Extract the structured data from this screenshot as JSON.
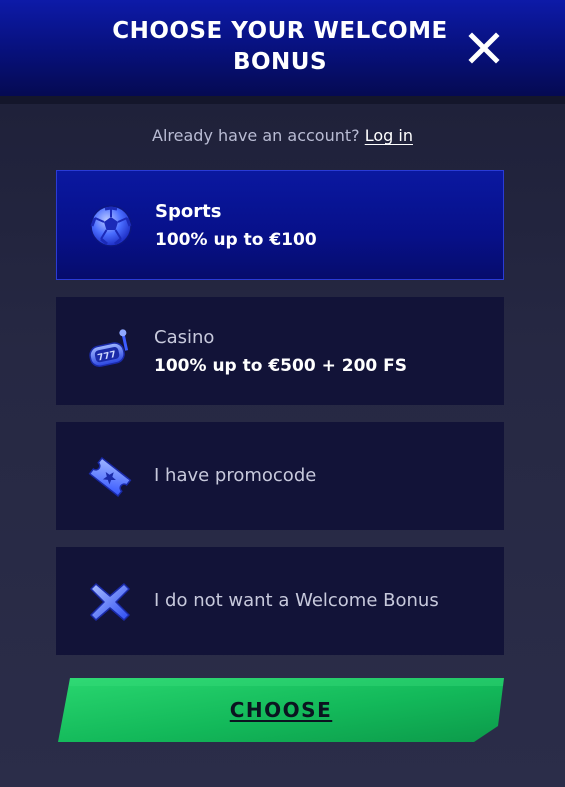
{
  "header": {
    "title": "CHOOSE YOUR WELCOME BONUS",
    "close_icon": "close-icon"
  },
  "login": {
    "prompt": "Already have an account?",
    "link_label": "Log in"
  },
  "options": [
    {
      "id": "sports",
      "title": "Sports",
      "subtitle": "100% up to €100",
      "icon": "soccer-ball-icon",
      "selected": true
    },
    {
      "id": "casino",
      "title": "Casino",
      "subtitle": "100% up to €500 + 200 FS",
      "icon": "slot-machine-icon",
      "selected": false
    },
    {
      "id": "promocode",
      "title": "I have promocode",
      "icon": "ticket-icon",
      "selected": false
    },
    {
      "id": "no-bonus",
      "title": "I do not want a Welcome Bonus",
      "icon": "cross-icon",
      "selected": false
    }
  ],
  "cta": {
    "label": "CHOOSE"
  },
  "colors": {
    "header": "#0a14a0",
    "selected_card": "#0a18a0",
    "card": "#121338",
    "cta_green": "#17c964",
    "background": "#272a45"
  }
}
